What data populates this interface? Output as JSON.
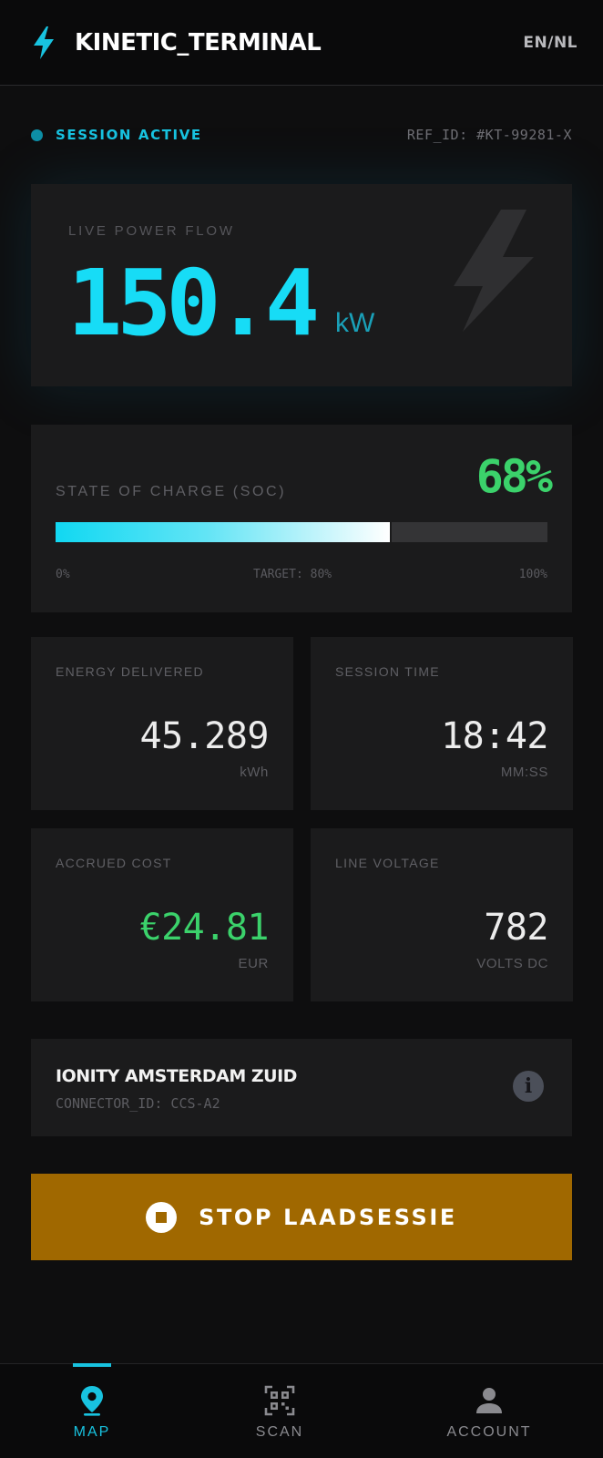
{
  "header": {
    "app_title": "KINETIC_TERMINAL",
    "language_toggle": "EN/NL",
    "logo_icon": "lightning-bolt-icon",
    "accent_color": "#18c3e0"
  },
  "status": {
    "label": "SESSION ACTIVE",
    "ref_id": "REF_ID: #KT-99281-X"
  },
  "power": {
    "label": "LIVE POWER FLOW",
    "value": "150.4",
    "unit": "kW"
  },
  "soc": {
    "label": "STATE OF CHARGE (SOC)",
    "value_text": "68%",
    "percent": 68,
    "target_percent": 80,
    "scale_min": "0%",
    "scale_target": "TARGET: 80%",
    "scale_max": "100%",
    "color": "#3bd26b"
  },
  "stats": {
    "energy": {
      "label": "ENERGY DELIVERED",
      "value": "45.289",
      "unit": "kWh"
    },
    "time": {
      "label": "SESSION TIME",
      "value": "18:42",
      "unit": "MM:SS"
    },
    "cost": {
      "label": "ACCRUED COST",
      "value": "€24.81",
      "unit": "EUR"
    },
    "voltage": {
      "label": "LINE VOLTAGE",
      "value": "782",
      "unit": "VOLTS DC"
    }
  },
  "station": {
    "name": "IONITY AMSTERDAM ZUID",
    "connector": "CONNECTOR_ID: CCS-A2"
  },
  "stop_button": {
    "label": "STOP LAADSESSIE",
    "color": "#a06800"
  },
  "nav": {
    "items": [
      {
        "label": "MAP",
        "icon": "map-pin-icon",
        "active": true
      },
      {
        "label": "SCAN",
        "icon": "qr-code-icon",
        "active": false
      },
      {
        "label": "ACCOUNT",
        "icon": "person-icon",
        "active": false
      }
    ]
  }
}
